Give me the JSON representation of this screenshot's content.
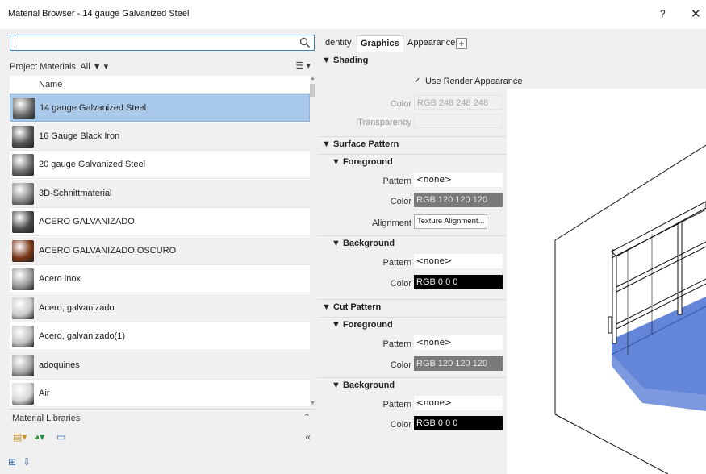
{
  "window": {
    "title": "Material Browser - 14 gauge Galvanized Steel",
    "help": "?",
    "close": "✕"
  },
  "browser": {
    "search": {
      "value": "",
      "placeholder": ""
    },
    "project_label": "Project Materials: All ▼ ▾",
    "list_view_icon": "☰ ▾",
    "column_name": "Name",
    "materials": [
      {
        "name": "14 gauge Galvanized Steel",
        "thumb": "#6a6a6a",
        "selected": true
      },
      {
        "name": "16 Gauge Black Iron",
        "thumb": "#555555"
      },
      {
        "name": "20 gauge Galvanized Steel",
        "thumb": "#6c6c6c"
      },
      {
        "name": "3D-Schnittmaterial",
        "thumb": "#8a8a8a"
      },
      {
        "name": "ACERO GALVANIZADO",
        "thumb": "#4a4a4a"
      },
      {
        "name": "ACERO GALVANIZADO OSCURO",
        "thumb": "#7a3516"
      },
      {
        "name": "Acero inox",
        "thumb": "#9a9a9a"
      },
      {
        "name": "Acero, galvanizado",
        "thumb": "#c9c9c9"
      },
      {
        "name": "Acero, galvanizado(1)",
        "thumb": "#c0c0c0"
      },
      {
        "name": "adoquines",
        "thumb": "#a5a5a5"
      },
      {
        "name": "Air",
        "thumb": "#d6d6d6"
      }
    ],
    "libraries_label": "Material Libraries",
    "libraries_expand": "⌃"
  },
  "editor": {
    "tabs": [
      {
        "label": "Identity"
      },
      {
        "label": "Graphics",
        "active": true
      },
      {
        "label": "Appearance"
      }
    ],
    "add_tab": "+",
    "shading": {
      "title": "▼ Shading",
      "use_render_label": "Use Render Appearance",
      "use_render_checked": "✓",
      "color_label": "Color",
      "color_value": "RGB 248 248 248",
      "transparency_label": "Transparency"
    },
    "surface_pattern": {
      "title": "▼ Surface Pattern",
      "foreground": {
        "title": "▼ Foreground",
        "pattern_label": "Pattern",
        "pattern_value": "<none>",
        "color_label": "Color",
        "color_value": "RGB 120 120 120",
        "alignment_label": "Alignment",
        "alignment_button": "Texture Alignment..."
      },
      "background": {
        "title": "▼ Background",
        "pattern_label": "Pattern",
        "pattern_value": "<none>",
        "color_label": "Color",
        "color_value": "RGB 0 0 0"
      }
    },
    "cut_pattern": {
      "title": "▼ Cut Pattern",
      "foreground": {
        "title": "▼ Foreground",
        "pattern_label": "Pattern",
        "pattern_value": "<none>",
        "color_label": "Color",
        "color_value": "RGB 120 120 120"
      },
      "background": {
        "title": "▼ Background",
        "pattern_label": "Pattern",
        "pattern_value": "<none>",
        "color_label": "Color",
        "color_value": "RGB 0 0 0"
      }
    }
  },
  "colors": {
    "selection": "#a9c9ea",
    "preview_fill": "#5b7fd6",
    "accent": "#3c7fb1"
  }
}
